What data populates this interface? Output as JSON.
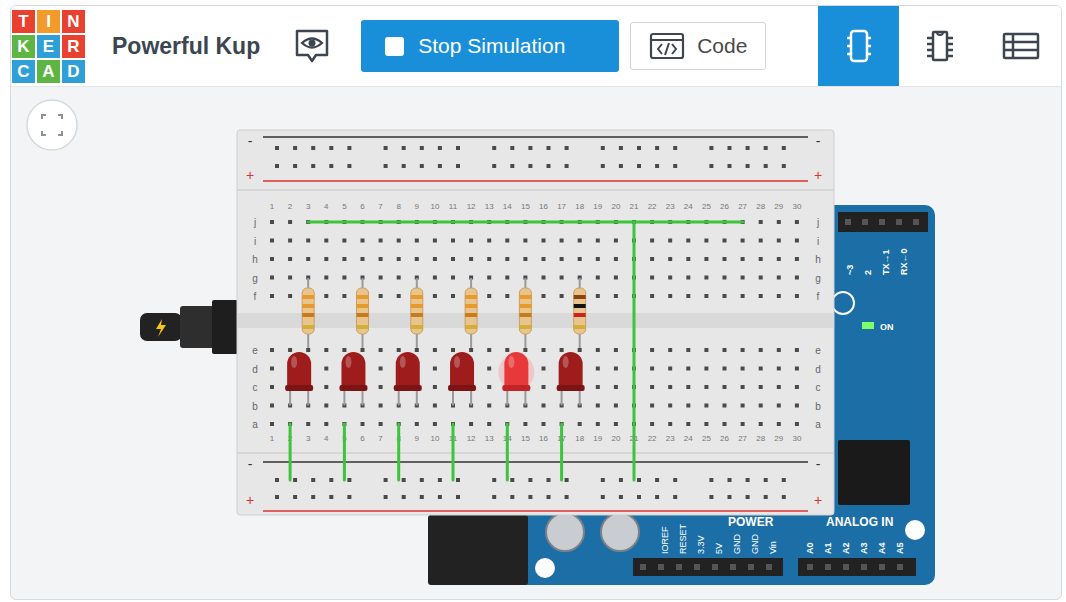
{
  "app": {
    "logo": [
      {
        "letter": "T",
        "color": "#e8412f"
      },
      {
        "letter": "I",
        "color": "#f29b2a"
      },
      {
        "letter": "N",
        "color": "#e8412f"
      },
      {
        "letter": "K",
        "color": "#5db544"
      },
      {
        "letter": "E",
        "color": "#2f9fd8"
      },
      {
        "letter": "R",
        "color": "#e8412f"
      },
      {
        "letter": "C",
        "color": "#2f9fd8"
      },
      {
        "letter": "A",
        "color": "#5db544"
      },
      {
        "letter": "D",
        "color": "#2f9fd8"
      }
    ],
    "title": "Powerful Kup"
  },
  "toolbar": {
    "simulation_button": "Stop Simulation",
    "simulating": true,
    "code_button": "Code"
  },
  "view_tabs": [
    {
      "kind": "circuit",
      "selected": true
    },
    {
      "kind": "schematic",
      "selected": false
    },
    {
      "kind": "components",
      "selected": false
    }
  ],
  "breadboard": {
    "columns": [
      "1",
      "2",
      "3",
      "4",
      "5",
      "6",
      "7",
      "8",
      "9",
      "10",
      "11",
      "12",
      "13",
      "14",
      "15",
      "16",
      "17",
      "18",
      "19",
      "20",
      "21",
      "22",
      "23",
      "24",
      "25",
      "26",
      "27",
      "28",
      "29",
      "30"
    ],
    "rows_top": [
      "j",
      "i",
      "h",
      "g",
      "f"
    ],
    "rows_bottom": [
      "e",
      "d",
      "c",
      "b",
      "a"
    ],
    "rail_minus": "-",
    "rail_plus": "+"
  },
  "circuit": {
    "leds": [
      {
        "on": false
      },
      {
        "on": false
      },
      {
        "on": false
      },
      {
        "on": false
      },
      {
        "on": true
      },
      {
        "on": false
      }
    ],
    "resistors": [
      {
        "bands": [
          "#e89a2c",
          "#e89a2c",
          "#c97a1c",
          "#d4af37"
        ]
      },
      {
        "bands": [
          "#e89a2c",
          "#e89a2c",
          "#c97a1c",
          "#d4af37"
        ]
      },
      {
        "bands": [
          "#e89a2c",
          "#e89a2c",
          "#c97a1c",
          "#d4af37"
        ]
      },
      {
        "bands": [
          "#e89a2c",
          "#e89a2c",
          "#c97a1c",
          "#d4af37"
        ]
      },
      {
        "bands": [
          "#e89a2c",
          "#e89a2c",
          "#c97a1c",
          "#d4af37"
        ]
      },
      {
        "bands": [
          "#8b4513",
          "#111111",
          "#cc2222",
          "#d4af37"
        ]
      }
    ]
  },
  "arduino": {
    "power_label": "POWER",
    "analog_label": "ANALOG IN",
    "power_pins": [
      "IOREF",
      "RESET",
      "3.3V",
      "5V",
      "GND",
      "GND",
      "Vin"
    ],
    "analog_pins": [
      "A0",
      "A1",
      "A2",
      "A3",
      "A4",
      "A5"
    ],
    "digital_pins": [
      "~3",
      "2",
      "TX→1",
      "RX←0"
    ],
    "on_label": "ON"
  }
}
